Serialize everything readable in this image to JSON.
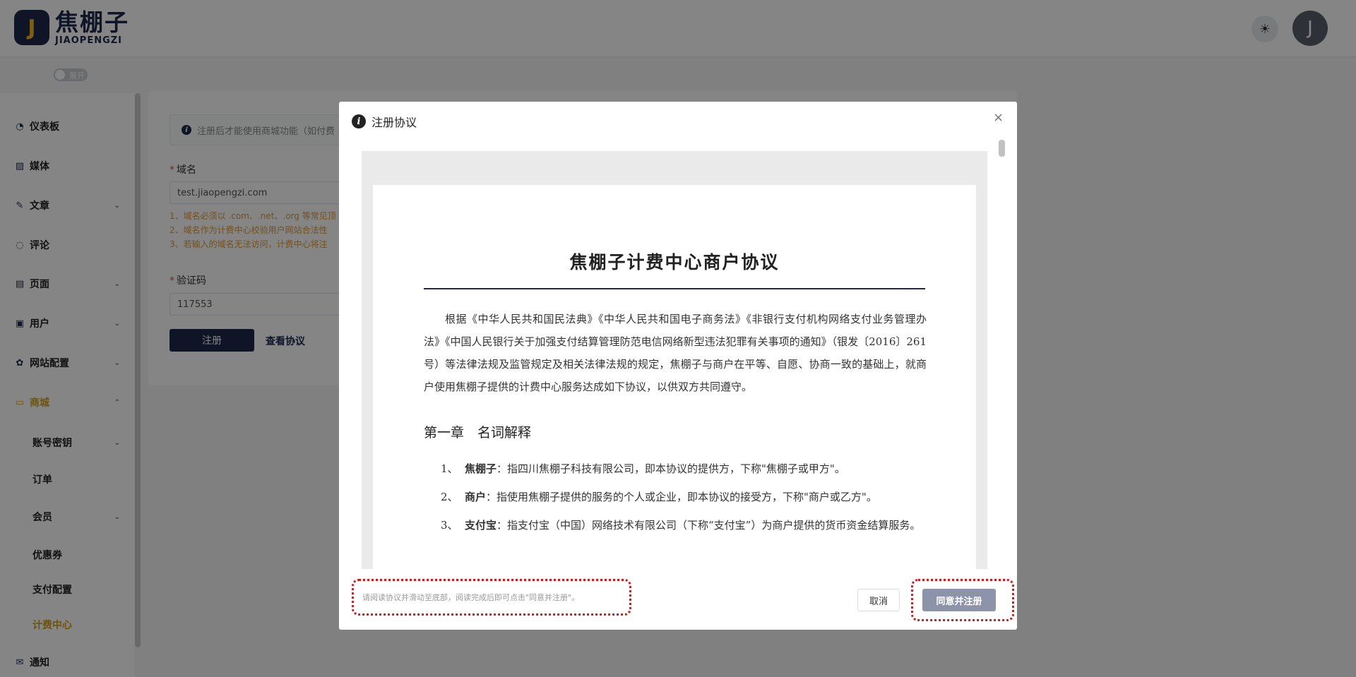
{
  "header": {
    "logo_letter": "J",
    "logo_cn": "焦棚子",
    "logo_en": "JIAOPENGZI",
    "theme_icon": "sun-icon",
    "avatar_letter": "J"
  },
  "sidebar_toggle": {
    "label": "展开"
  },
  "sidebar": {
    "items": [
      {
        "label": "仪表板",
        "icon": "dashboard-icon"
      },
      {
        "label": "媒体",
        "icon": "image-icon"
      },
      {
        "label": "文章",
        "icon": "edit-icon"
      },
      {
        "label": "评论",
        "icon": "comment-icon"
      },
      {
        "label": "页面",
        "icon": "page-icon"
      },
      {
        "label": "用户",
        "icon": "user-card-icon"
      },
      {
        "label": "网站配置",
        "icon": "gear-icon"
      },
      {
        "label": "商城",
        "icon": "shop-icon"
      },
      {
        "label": "通知",
        "icon": "mail-icon"
      }
    ],
    "sub_items": [
      {
        "label": "账号密钥"
      },
      {
        "label": "订单"
      },
      {
        "label": "会员"
      },
      {
        "label": "优惠券"
      },
      {
        "label": "支付配置"
      },
      {
        "label": "计费中心"
      }
    ]
  },
  "form": {
    "notice": "注册后才能使用商城功能（如付费",
    "domain_label": "域名",
    "domain_value": "test.jiaopengzi.com",
    "hints": [
      "1、域名必须以 .com、.net、.org 等常见顶",
      "2、域名作为计费中心校验用户网站合法性",
      "3、若输入的域名无法访问，计费中心将注"
    ],
    "code_label": "验证码",
    "code_value": "117553",
    "register_label": "注册",
    "view_label": "查看协议"
  },
  "dialog": {
    "title": "注册协议",
    "close": "×",
    "doc": {
      "title": "焦棚子计费中心商户协议",
      "intro": "根据《中华人民共和国民法典》《中华人民共和国电子商务法》《非银行支付机构网络支付业务管理办法》《中国人民银行关于加强支付结算管理防范电信网络新型违法犯罪有关事项的通知》（银发〔2016〕261号）等法律法规及监管规定及相关法律法规的规定，焦棚子与商户在平等、自愿、协商一致的基础上，就商户使用焦棚子提供的计费中心服务达成如下协议，以供双方共同遵守。",
      "chapter": "第一章　名词解释",
      "items": [
        {
          "num": "1、",
          "term": "焦棚子",
          "text": "：指四川焦棚子科技有限公司，即本协议的提供方，下称\"焦棚子或甲方\"。"
        },
        {
          "num": "2、",
          "term": "商户",
          "text": "：指使用焦棚子提供的服务的个人或企业，即本协议的接受方，下称\"商户或乙方\"。"
        },
        {
          "num": "3、",
          "term": "支付宝",
          "text": "：指支付宝（中国）网络技术有限公司（下称“支付宝”）为商户提供的货币资金结算服务。"
        }
      ]
    },
    "footer_hint": "请阅读协议并滑动至底部，阅读完成后即可点击\"同意并注册\"。",
    "cancel_label": "取消",
    "agree_label": "同意并注册"
  }
}
